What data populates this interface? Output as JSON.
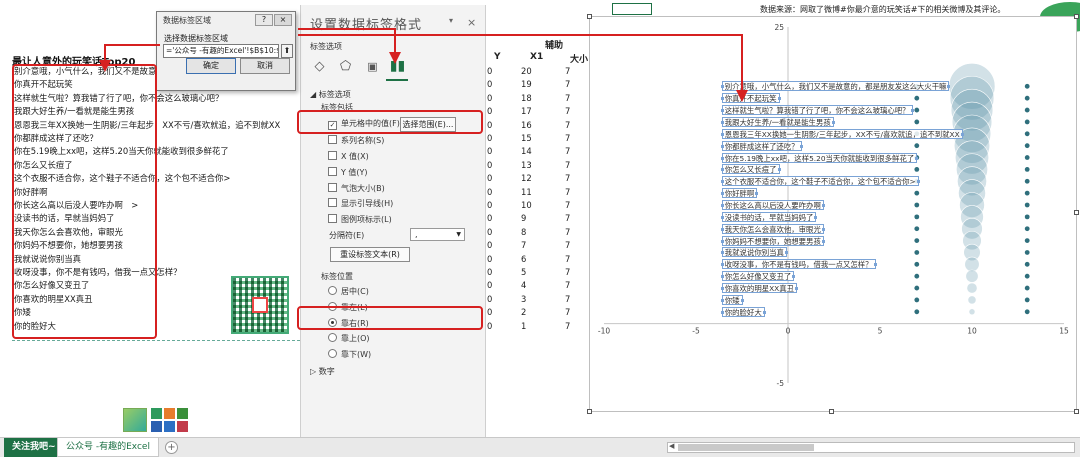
{
  "sheet": {
    "title": "最让人意外的玩笑话Top20",
    "list": [
      "别介意哦，小气什么，我们又不是故意的",
      "你真开不起玩笑",
      "这样就生气啦？算我错了行了吧，你不会这么玻璃心吧？",
      "我跟大好生养/一看就是能生男孩",
      "恩恩我三年XX换她一生阴影/三年起步，XX不亏/喜欢就追，追不到就XX",
      "你都胖成这样了还吃？",
      "你在5.19晚上xx吧，这样5.20当天你就能收到很多鲜花了",
      "你怎么又长痘了",
      "这个衣服不适合你，这个鞋子不适合你，这个包不适合你>",
      "你好胖啊",
      "你长这么高以后没人要咋办啊　>",
      "没读书的话，早就当妈妈了",
      "我天你怎么会喜欢他，审眼光",
      "你妈妈不想要你，她想要男孩",
      "我就说说你别当真",
      "收呀没事，你不是有钱吗，借我一点又怎样？",
      "你怎么好像又变丑了",
      "你喜欢的明星XX真丑",
      "你矮",
      "你的脸好大"
    ],
    "col_headers": {
      "y": "Y",
      "x1": "X1",
      "x2": "大小"
    },
    "group_header": "辅助",
    "y_values": [
      0,
      0,
      0,
      0,
      0,
      0,
      0,
      0,
      0,
      0,
      0,
      0,
      0,
      0,
      0,
      0,
      0,
      0,
      0,
      0
    ],
    "x1_values": [
      20,
      19,
      18,
      17,
      16,
      15,
      14,
      13,
      12,
      11,
      10,
      9,
      8,
      7,
      6,
      5,
      4,
      3,
      2,
      1
    ],
    "x2_values": [
      7,
      7,
      7,
      7,
      7,
      7,
      7,
      7,
      7,
      7,
      7,
      7,
      7,
      7,
      7,
      7,
      7,
      7,
      7,
      7
    ]
  },
  "dialog": {
    "title": "数据标签区域",
    "help": "?",
    "close": "×",
    "label": "选择数据标签区域",
    "input_value": "='公众号 -有趣的Excel'!$B$10:$B$",
    "ok": "确定",
    "cancel": "取消"
  },
  "pane": {
    "title": "设置数据标签格式",
    "close": "×",
    "ctrl": "▾",
    "tab_label": "标签选项",
    "section_label_options": "◢ 标签选项",
    "section_contains": "标签包括",
    "cell_value": "单元格中的值(F)",
    "select_range": "选择范围(E)...",
    "series_name": "系列名称(S)",
    "x_value": "X 值(X)",
    "y_value": "Y 值(Y)",
    "bubble_size": "气泡大小(B)",
    "leader_lines": "显示引导线(H)",
    "legend_key": "图例项标示(L)",
    "separator_label": "分隔符(E)",
    "separator_value": ",",
    "reset_text": "重设标签文本(R)",
    "position_label": "标签位置",
    "pos_center": "居中(C)",
    "pos_left": "靠左(L)",
    "pos_right": "靠右(R)",
    "pos_above": "靠上(O)",
    "pos_below": "靠下(W)",
    "section_number": "数字"
  },
  "tabs": {
    "tab1": "关注我吧~",
    "tab2": "公众号 -有趣的Excel",
    "add": "+"
  },
  "chart": {
    "source_note": "数据来源：网取了微博#你最介意的玩笑话#下的相关微博及其评论。",
    "bubble_color": "#5e93a8",
    "dot_color": "#2f6f7c",
    "highlight_color": "#d62020"
  },
  "chart_data": {
    "type": "scatter",
    "x_ticks": [
      -10,
      -5,
      0,
      5,
      10,
      15
    ],
    "y_ticks": [
      25,
      20,
      15,
      10,
      5,
      0,
      -5
    ],
    "xlim": [
      -10,
      15
    ],
    "ylim": [
      -5,
      25
    ],
    "grid": false,
    "dot_series": [
      {
        "x": 7,
        "values": [
          20,
          19,
          18,
          17,
          16,
          15,
          14,
          13,
          12,
          11,
          10,
          9,
          8,
          7,
          6,
          5,
          4,
          3,
          2,
          1
        ]
      },
      {
        "x": 13,
        "values": [
          20,
          19,
          18,
          17,
          16,
          15,
          14,
          13,
          12,
          11,
          10,
          9,
          8,
          7,
          6,
          5,
          4,
          3,
          2,
          1
        ]
      }
    ],
    "bubbles": {
      "x": 10,
      "y": [
        20,
        19,
        18,
        17,
        16,
        15,
        14,
        13,
        12,
        11,
        10,
        9,
        8,
        7,
        6,
        5,
        4,
        3,
        2,
        1
      ],
      "sizes": [
        20,
        19,
        18,
        17,
        16,
        15,
        14,
        13,
        12,
        11,
        10,
        9,
        8,
        7,
        6,
        5,
        4,
        3,
        2,
        1
      ]
    },
    "labels": [
      "别介意哦，小气什么，我们又不是故意的，都是朋友发这么大火干嘛",
      "你真开不起玩笑",
      "这样就生气啦？算我错了行了吧，你不会这么玻璃心吧？",
      "我跟大好生养/一看就是能生男孩",
      "恩恩我三年XX换她一生阴影/三年起步，XX不亏/喜欢就追，追不到就XX",
      "你都胖成这样了还吃？",
      "你在5.19晚上xx吧，这样5.20当天你就能收到很多鲜花了",
      "你怎么又长痘了",
      "这个衣服不适合你，这个鞋子不适合你，这个包不适合你>",
      "你好胖啊",
      "你长这么高以后没人要咋办啊",
      "没读书的话，早就当妈妈了",
      "我天你怎么会喜欢他，审眼光",
      "你妈妈不想要你，她想要男孩",
      "我就说说你别当真",
      "收呀没事，你不是有钱吗，借我一点又怎样？",
      "你怎么好像又变丑了",
      "你喜欢的明星XX真丑",
      "你矮",
      "你的脸好大"
    ]
  }
}
